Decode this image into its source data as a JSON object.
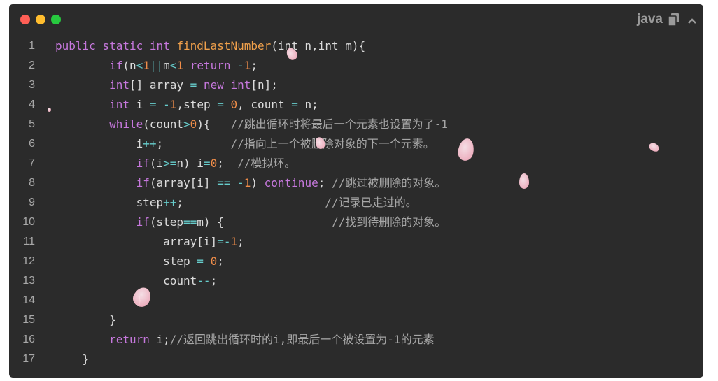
{
  "window": {
    "language": "java",
    "icons": [
      "copy-icon",
      "chevron-up-icon"
    ]
  },
  "code": {
    "lines": [
      {
        "n": "1",
        "tokens": [
          [
            "kw",
            "public static int "
          ],
          [
            "fn",
            "findLastNumber"
          ],
          [
            "",
            "(int n,int m){"
          ]
        ]
      },
      {
        "n": "2",
        "tokens": [
          [
            "",
            "        "
          ],
          [
            "kw",
            "if"
          ],
          [
            "",
            "(n"
          ],
          [
            "op",
            "<"
          ],
          [
            "num",
            "1"
          ],
          [
            "op",
            "||"
          ],
          [
            "",
            "m"
          ],
          [
            "op",
            "<"
          ],
          [
            "num",
            "1"
          ],
          [
            "",
            " "
          ],
          [
            "kw",
            "return"
          ],
          [
            "",
            " "
          ],
          [
            "op",
            "-"
          ],
          [
            "num",
            "1"
          ],
          [
            "",
            ";"
          ]
        ]
      },
      {
        "n": "3",
        "tokens": [
          [
            "",
            "        "
          ],
          [
            "kw",
            "int"
          ],
          [
            "",
            "[] array "
          ],
          [
            "op",
            "="
          ],
          [
            "",
            " "
          ],
          [
            "kw",
            "new"
          ],
          [
            "",
            " "
          ],
          [
            "kw",
            "int"
          ],
          [
            "",
            "[n];"
          ]
        ]
      },
      {
        "n": "4",
        "tokens": [
          [
            "",
            "        "
          ],
          [
            "kw",
            "int"
          ],
          [
            "",
            " i "
          ],
          [
            "op",
            "="
          ],
          [
            "",
            " "
          ],
          [
            "op",
            "-"
          ],
          [
            "num",
            "1"
          ],
          [
            "",
            ",step "
          ],
          [
            "op",
            "="
          ],
          [
            "",
            " "
          ],
          [
            "num",
            "0"
          ],
          [
            "",
            ", count "
          ],
          [
            "op",
            "="
          ],
          [
            "",
            " n;"
          ]
        ]
      },
      {
        "n": "5",
        "tokens": [
          [
            "",
            "        "
          ],
          [
            "kw",
            "while"
          ],
          [
            "",
            "(count"
          ],
          [
            "op",
            ">"
          ],
          [
            "num",
            "0"
          ],
          [
            "",
            "){   "
          ],
          [
            "cm",
            "//跳出循环时将最后一个元素也设置为了-1"
          ]
        ]
      },
      {
        "n": "6",
        "tokens": [
          [
            "",
            "            i"
          ],
          [
            "op",
            "++"
          ],
          [
            "",
            ";          "
          ],
          [
            "cm",
            "//指向上一个被删除对象的下一个元素。"
          ]
        ]
      },
      {
        "n": "7",
        "tokens": [
          [
            "",
            "            "
          ],
          [
            "kw",
            "if"
          ],
          [
            "",
            "(i"
          ],
          [
            "op",
            ">="
          ],
          [
            "",
            "n) i"
          ],
          [
            "op",
            "="
          ],
          [
            "num",
            "0"
          ],
          [
            "",
            ";  "
          ],
          [
            "cm",
            "//模拟环。"
          ]
        ]
      },
      {
        "n": "8",
        "tokens": [
          [
            "",
            "            "
          ],
          [
            "kw",
            "if"
          ],
          [
            "",
            "(array[i] "
          ],
          [
            "op",
            "=="
          ],
          [
            "",
            " "
          ],
          [
            "op",
            "-"
          ],
          [
            "num",
            "1"
          ],
          [
            "",
            ") "
          ],
          [
            "kw",
            "continue"
          ],
          [
            "",
            "; "
          ],
          [
            "cm",
            "//跳过被删除的对象。"
          ]
        ]
      },
      {
        "n": "9",
        "tokens": [
          [
            "",
            "            step"
          ],
          [
            "op",
            "++"
          ],
          [
            "",
            ";                     "
          ],
          [
            "cm",
            "//记录已走过的。"
          ]
        ]
      },
      {
        "n": "10",
        "tokens": [
          [
            "",
            "            "
          ],
          [
            "kw",
            "if"
          ],
          [
            "",
            "(step"
          ],
          [
            "op",
            "=="
          ],
          [
            "",
            "m) {                "
          ],
          [
            "cm",
            "//找到待删除的对象。"
          ]
        ]
      },
      {
        "n": "11",
        "tokens": [
          [
            "",
            "                array[i]"
          ],
          [
            "op",
            "="
          ],
          [
            "op",
            "-"
          ],
          [
            "num",
            "1"
          ],
          [
            "",
            ";"
          ]
        ]
      },
      {
        "n": "12",
        "tokens": [
          [
            "",
            "                step "
          ],
          [
            "op",
            "="
          ],
          [
            "",
            " "
          ],
          [
            "num",
            "0"
          ],
          [
            "",
            ";"
          ]
        ]
      },
      {
        "n": "13",
        "tokens": [
          [
            "",
            "                count"
          ],
          [
            "op",
            "--"
          ],
          [
            "",
            ";"
          ]
        ]
      },
      {
        "n": "14",
        "tokens": [
          [
            "",
            "            }"
          ]
        ]
      },
      {
        "n": "15",
        "tokens": [
          [
            "",
            "        }"
          ]
        ]
      },
      {
        "n": "16",
        "tokens": [
          [
            "",
            "        "
          ],
          [
            "kw",
            "return"
          ],
          [
            "",
            " i;"
          ],
          [
            "cm",
            "//返回跳出循环时的i,即最后一个被设置为-1的元素"
          ]
        ]
      },
      {
        "n": "17",
        "tokens": [
          [
            "",
            "    }"
          ]
        ]
      }
    ]
  },
  "colors": {
    "background": "#2b2b2b",
    "keyword": "#c678dd",
    "function": "#f0a04b",
    "number": "#f08d49",
    "operator": "#67cdcc",
    "comment": "#a6a6a6"
  }
}
